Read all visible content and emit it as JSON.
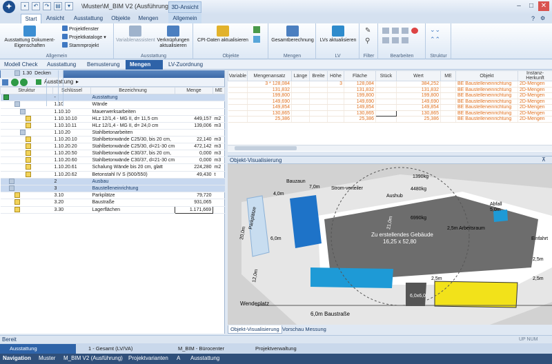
{
  "title_bar": {
    "window_title": "\\Muster\\M_BIM V2 (Ausführung)...",
    "context_tab": "3D-Ansicht",
    "app_logo": "app-logo-icon"
  },
  "ribbon_tabs": [
    "Start",
    "Ansicht",
    "Ausstattung",
    "Objekte",
    "Mengen",
    "Allgemein"
  ],
  "ribbon": {
    "allgemein": {
      "btn": "Ausstattung Dokument-Eigenschaften",
      "small1": "Projektfenster",
      "small2": "Projektkataloge",
      "small3": "Stammprojekt",
      "label": "Allgemein"
    },
    "ausstattung": {
      "btn1": "Variablenassistent",
      "btn2": "Verknüpfungen aktualisieren",
      "label": "Ausstattung"
    },
    "objekte": {
      "btn": "CPI-Daten aktualisieren",
      "label": "Objekte"
    },
    "mengen": {
      "btn": "Gesamtberechnung",
      "label": "Mengen"
    },
    "lv": {
      "btn": "LVs aktualisieren",
      "label": "LV"
    },
    "filter": {
      "label": "Filter"
    },
    "bearbeiten": {
      "label": "Bearbeiten"
    },
    "struktur": {
      "label": "Struktur"
    }
  },
  "breadcrumbs": [
    "Modell Check",
    "Ausstattung",
    "Bemusterung",
    "Mengen",
    "LV-Zuordnung"
  ],
  "left_panel": {
    "title": "Ausstattungs-Tabelle",
    "path": "Ausstattung",
    "columns": [
      "Struktur",
      "Schlüssel",
      "Bezeichnung",
      "Menge",
      "ME"
    ],
    "rows": [
      {
        "key": "-",
        "name": "Ausstattung",
        "qty": "",
        "me": "",
        "style": "grp2",
        "icon": "green",
        "indent": 0
      },
      {
        "key": "1",
        "name": "Rohbau",
        "qty": "",
        "me": "",
        "style": "grp",
        "icon": "folder",
        "indent": 1
      },
      {
        "key": "1.10",
        "name": "Wände",
        "qty": "",
        "me": "",
        "style": "",
        "icon": "folder",
        "indent": 2
      },
      {
        "key": "1.10.10",
        "name": "Mauerwerksarbeiten",
        "qty": "",
        "me": "",
        "style": "",
        "icon": "folder",
        "indent": 3
      },
      {
        "key": "1.10.10.10",
        "name": "HLz 12/1,4 - MG II, d= 11,5 cm",
        "qty": "449,157",
        "me": "m2",
        "style": "",
        "icon": "pos",
        "indent": 4
      },
      {
        "key": "1.10.10.11",
        "name": "HLz 12/1,4 - MG II, d= 24,0 cm",
        "qty": "139,006",
        "me": "m3",
        "style": "",
        "icon": "pos",
        "indent": 4
      },
      {
        "key": "1.10.20",
        "name": "Stahlbetonarbeiten",
        "qty": "",
        "me": "",
        "style": "",
        "icon": "folder",
        "indent": 3
      },
      {
        "key": "1.10.20.10",
        "name": "Stahlbetonwände C25/30, bis 20 cm,",
        "qty": "22,140",
        "me": "m3",
        "style": "",
        "icon": "pos",
        "indent": 4
      },
      {
        "key": "1.10.20.20",
        "name": "Stahlbetonwände C25/30, d=21-30 cm",
        "qty": "472,142",
        "me": "m3",
        "style": "",
        "icon": "pos",
        "indent": 4
      },
      {
        "key": "1.10.20.50",
        "name": "Stahlbetonwände C30/37, bis 20 cm,",
        "qty": "0,000",
        "me": "m3",
        "style": "",
        "icon": "pos",
        "indent": 4
      },
      {
        "key": "1.10.20.60",
        "name": "Stahlbetonwände C30/37, d=21-30 cm",
        "qty": "0,000",
        "me": "m3",
        "style": "",
        "icon": "pos",
        "indent": 4
      },
      {
        "key": "1.10.20.61",
        "name": "Schalung Wände bis 20 cm, glatt",
        "qty": "224,280",
        "me": "m2",
        "style": "",
        "icon": "pos",
        "indent": 4
      },
      {
        "key": "1.10.20.62",
        "name": "Betonstahl IV S (500/550)",
        "qty": "49,430",
        "me": "t",
        "style": "",
        "icon": "pos",
        "indent": 4
      },
      {
        "key": "1.20",
        "name": "Fertigteile",
        "qty": "",
        "me": "",
        "style": "grp",
        "icon": "folder",
        "indent": 2
      },
      {
        "key": "1.30",
        "name": "Decken",
        "qty": "",
        "me": "",
        "style": "grp",
        "icon": "folder",
        "indent": 2
      },
      {
        "key": "2",
        "name": "Ausbau",
        "qty": "",
        "me": "",
        "style": "grp2",
        "icon": "folder",
        "indent": 1
      },
      {
        "key": "3",
        "name": "Baustelleneinrichtung",
        "qty": "",
        "me": "",
        "style": "grp2",
        "icon": "folder",
        "indent": 1
      },
      {
        "key": "3.10",
        "name": "Parkplätze",
        "qty": "79,720",
        "me": "",
        "style": "",
        "icon": "pos",
        "indent": 2
      },
      {
        "key": "3.20",
        "name": "Baustraße",
        "qty": "931,065",
        "me": "",
        "style": "",
        "icon": "pos",
        "indent": 2
      },
      {
        "key": "3.30",
        "name": "Lagerflächen",
        "qty": "1.171,669",
        "me": "",
        "style": "",
        "icon": "pos",
        "indent": 2
      }
    ]
  },
  "right_table": {
    "columns": [
      "Variable",
      "Mengenansatz",
      "Länge",
      "Breite",
      "Höhe",
      "Fläche",
      "Stück",
      "Wert",
      "ME",
      "Objekt",
      "Instanz-Herkunft"
    ],
    "rows": [
      {
        "ansatz": "3 * 128,084",
        "hoehe": "3",
        "flaeche": "128,084",
        "wert": "384,252",
        "objekt": "BE Baustelleneinrichtung",
        "herkunft": "2D-Mengen"
      },
      {
        "ansatz": "131,832",
        "hoehe": "",
        "flaeche": "131,832",
        "wert": "131,832",
        "objekt": "BE Baustelleneinrichtung",
        "herkunft": "2D-Mengen"
      },
      {
        "ansatz": "199,800",
        "hoehe": "",
        "flaeche": "199,800",
        "wert": "199,800",
        "objekt": "BE Baustelleneinrichtung",
        "herkunft": "2D-Mengen"
      },
      {
        "ansatz": "149,690",
        "hoehe": "",
        "flaeche": "149,690",
        "wert": "149,690",
        "objekt": "BE Baustelleneinrichtung",
        "herkunft": "2D-Mengen"
      },
      {
        "ansatz": "149,854",
        "hoehe": "",
        "flaeche": "149,854",
        "wert": "149,854",
        "objekt": "BE Baustelleneinrichtung",
        "herkunft": "2D-Mengen"
      },
      {
        "ansatz": "130,865",
        "hoehe": "",
        "flaeche": "130,865",
        "wert": "130,865",
        "objekt": "BE Baustelleneinrichtung",
        "herkunft": "2D-Mengen"
      },
      {
        "ansatz": "25,386",
        "hoehe": "",
        "flaeche": "25,386",
        "wert": "25,386",
        "objekt": "BE Baustelleneinrichtung",
        "herkunft": "2D-Mengen"
      }
    ]
  },
  "visualization": {
    "title": "Objekt-Visualisierung",
    "labels": {
      "bauzaun": "Bauzaun",
      "stromverteiler": "Strom-verteiler",
      "aushub": "Aushub",
      "abfall": "Abfall",
      "arbeitsraum": "2,5m Arbeitsraum",
      "gebaeude": "Zu erstellendes Gebäude",
      "gebaeude_dim": "16,25 x 52,80",
      "parkplatz": "Parkplätze",
      "baustrasse": "6,0m Baustraße",
      "wendeplatz": "Wendeplatz",
      "einfahrt": "Einfahrt",
      "crane1": "4480kg",
      "crane2": "6990kg",
      "box": "6,0x6,0",
      "d1": "7,0m",
      "d2": "4,0m",
      "d3": "20,0m",
      "d4": "6,0m",
      "d5": "12,0m",
      "d6": "21,0m",
      "d7": "2,5m",
      "d8": "2,5m",
      "d9": "5,0m",
      "d10": "2,5m",
      "d11": "1390kg"
    }
  },
  "viz_tabs": [
    "Objekt-Visualisierung",
    "Vorschau Messung"
  ],
  "status": {
    "text": "Bereit",
    "indicators": "UP NUM SCRL"
  },
  "doc_tabs": [
    "Ausstattung",
    "1 - Gesamt (LV/VA)",
    "M_BIM - Bürocenter Königs...",
    "Projektverwaltung"
  ],
  "nav": {
    "label": "Navigation",
    "path": [
      "Muster",
      "M_BIM V2 (Ausführung)",
      "Projektvarianten",
      "A",
      "Ausstattung"
    ]
  },
  "colors": {
    "accent": "#2e63a8",
    "orange_text": "#e0701e",
    "blue_object": "#1e9ad6",
    "yellow_object": "#f2e21a"
  }
}
